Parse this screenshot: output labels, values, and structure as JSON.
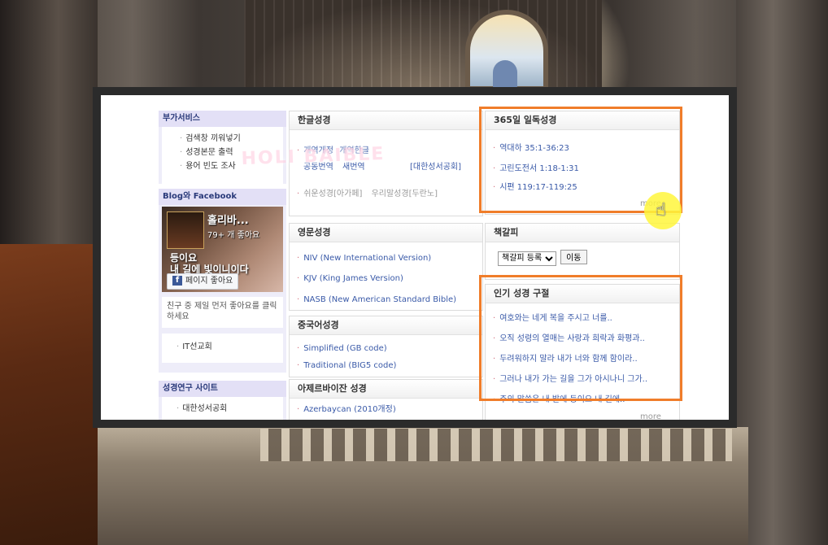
{
  "sidebar": {
    "services": {
      "title": "부가서비스",
      "items": [
        "검색창 끼워넣기",
        "성경본문 출력",
        "용어 빈도 조사"
      ]
    },
    "social": {
      "title": "Blog와 Facebook",
      "page_name": "홀리바...",
      "likes": "79+ 개 좋아요",
      "calligraphy_line1": "등이요",
      "calligraphy_line2": "내 길에 빛이니이다",
      "like_button": "페이지 좋아요",
      "friend_prompt": "친구 중 제일 먼저 좋아요를 클릭하세요",
      "church_link": "IT선교회"
    },
    "research": {
      "title": "성경연구 사이트",
      "items": [
        "대한성서공회"
      ]
    }
  },
  "korean_bible": {
    "title": "한글성경",
    "row1_prefix": "개역개정",
    "row1_link": "개역한글",
    "row2_a": "공동번역",
    "row2_b": "새번역",
    "row2_c": "[대한성서공회]",
    "row3_a": "쉬운성경[아가페]",
    "row3_b": "우리말성경[두란노]"
  },
  "english_bible": {
    "title": "영문성경",
    "items": [
      "NIV (New International Version)",
      "KJV (King James Version)",
      "NASB (New American Standard Bible)"
    ]
  },
  "chinese_bible": {
    "title": "중국어성경",
    "items": [
      "Simplified (GB code)",
      "Traditional (BIG5 code)"
    ]
  },
  "azerbaijani_bible": {
    "title": "아제르바이잔 성경",
    "items": [
      "Azerbaycan (2010개정)"
    ]
  },
  "daily_reading": {
    "title": "365일 일독성경",
    "items": [
      "역대하 35:1-36:23",
      "고린도전서 1:18-1:31",
      "시편 119:17-119:25"
    ],
    "more": "more"
  },
  "bookmark": {
    "title": "책갈피",
    "select_value": "책갈피 등록",
    "go_button": "이동"
  },
  "popular_verses": {
    "title": "인기 성경 구절",
    "items": [
      "여호와는 네게 복을 주시고 너를..",
      "오직 성령의 열매는 사랑과 희락과 화평과..",
      "두려워하지 말라 내가 너와 함께 함이라..",
      "그러나 내가 가는 길을 그가 아시나니 그가..",
      "주의 말씀은 내 발에 등이요 내 길에.."
    ],
    "more": "more"
  },
  "watermark_text": "HOLI BAIBLE",
  "colors": {
    "highlight": "#f07d2a",
    "link": "#3a5aa8",
    "sidebar_head": "#e3e0f6"
  }
}
